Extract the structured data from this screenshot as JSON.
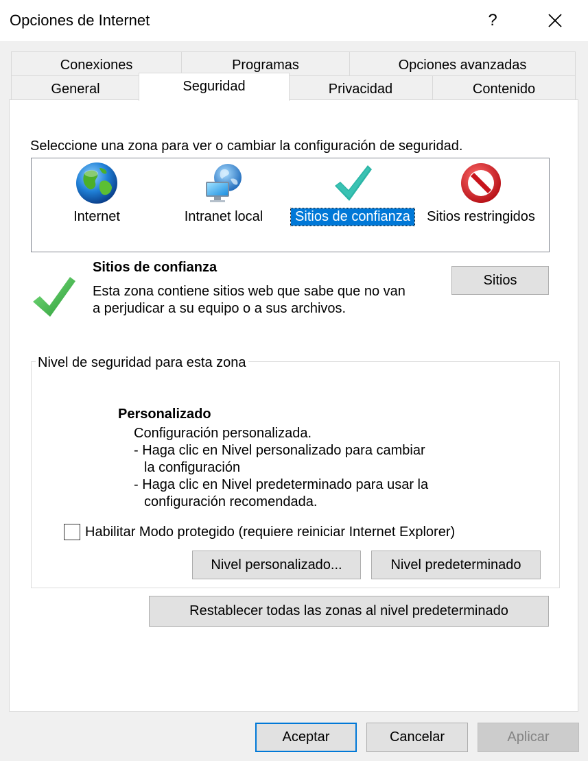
{
  "window": {
    "title": "Opciones de Internet",
    "help_icon": "question-mark-icon",
    "help_glyph": "?",
    "close_icon": "close-icon"
  },
  "tabs": {
    "row1": [
      {
        "label": "Conexiones"
      },
      {
        "label": "Programas"
      },
      {
        "label": "Opciones avanzadas"
      }
    ],
    "row2": [
      {
        "label": "General"
      },
      {
        "label": "Seguridad",
        "active": true
      },
      {
        "label": "Privacidad"
      },
      {
        "label": "Contenido"
      }
    ]
  },
  "security": {
    "prompt": "Seleccione una zona para ver o cambiar la configuración de seguridad.",
    "zones": [
      {
        "label": "Internet",
        "icon": "globe-icon"
      },
      {
        "label": "Intranet local",
        "icon": "intranet-icon"
      },
      {
        "label": "Sitios de confianza",
        "icon": "checkmark-icon",
        "selected": true
      },
      {
        "label": "Sitios restringidos",
        "icon": "no-entry-icon"
      }
    ],
    "selected_zone": {
      "title": "Sitios de confianza",
      "description": "Esta zona contiene sitios web que sabe que no van a perjudicar a su equipo o a sus archivos.",
      "sites_button": "Sitios",
      "icon": "checkmark-icon"
    },
    "level_group": {
      "label": "Nivel de seguridad para esta zona",
      "level_title": "Personalizado",
      "lines": [
        "Configuración personalizada.",
        "- Haga clic en Nivel personalizado para cambiar",
        "la configuración",
        "- Haga clic en Nivel predeterminado para usar la",
        "configuración recomendada."
      ],
      "protected_mode_label": "Habilitar Modo protegido (requiere reiniciar Internet Explorer)",
      "protected_mode_checked": false,
      "custom_level_button": "Nivel personalizado...",
      "default_level_button": "Nivel predeterminado"
    },
    "reset_all_button": "Restablecer todas las zonas al nivel predeterminado"
  },
  "footer": {
    "ok": "Aceptar",
    "cancel": "Cancelar",
    "apply": "Aplicar",
    "apply_enabled": false
  },
  "colors": {
    "selection": "#0078d7",
    "check_green": "#3ab54a",
    "restricted_red": "#d3141b"
  }
}
